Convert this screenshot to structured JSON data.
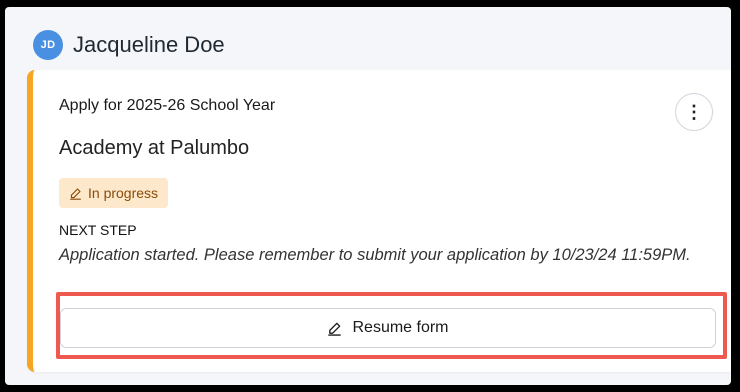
{
  "student": {
    "initials": "JD",
    "name": "Jacqueline Doe"
  },
  "application": {
    "title": "Apply for 2025-26 School Year",
    "school": "Academy at Palumbo",
    "status": "In progress",
    "next_step_label": "NEXT STEP",
    "next_step_text": "Application started. Please remember to submit your application by 10/23/24 11:59PM.",
    "more_icon": "⋮",
    "resume_label": "Resume form"
  },
  "icons": {
    "status": "pencil-icon",
    "resume": "pencil-icon",
    "more": "more-vertical-icon"
  },
  "colors": {
    "accent_border": "#f5a623",
    "badge_bg": "#fde8cc",
    "badge_text": "#8a4b08",
    "avatar_bg": "#4a90e2",
    "highlight": "#ee5a4f"
  }
}
